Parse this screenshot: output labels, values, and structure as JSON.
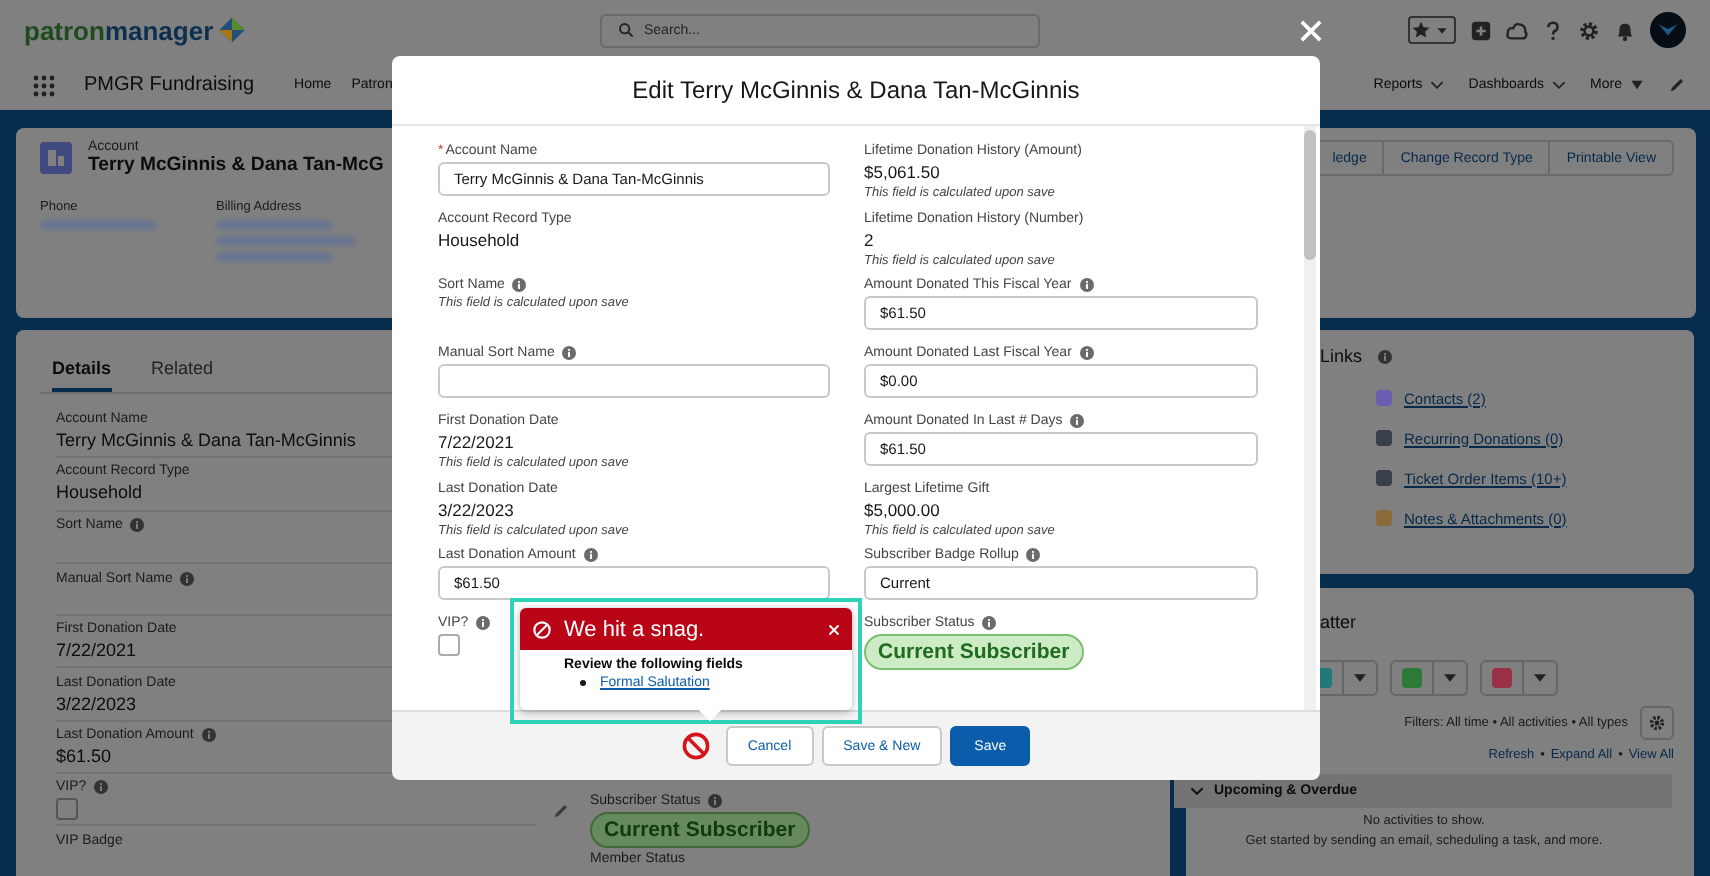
{
  "header": {
    "logo_lead": "patron",
    "logo_rest": "manager",
    "search": {
      "placeholder": "Search..."
    }
  },
  "nav": {
    "app_name": "PMGR Fundraising",
    "items": [
      {
        "label": "Home",
        "selected": false
      },
      {
        "label": "Patron",
        "selected": false
      }
    ],
    "right_items": [
      {
        "label": "Reports",
        "kind": "menu"
      },
      {
        "label": "Dashboards",
        "kind": "menu"
      },
      {
        "label": "More",
        "kind": "overflow"
      }
    ]
  },
  "record": {
    "object": "Account",
    "title": "Terry McGinnis & Dana Tan-McG",
    "fields": [
      {
        "label": "Phone"
      },
      {
        "label": "Billing Address"
      }
    ],
    "actions": [
      "ledge",
      "Change Record Type",
      "Printable View"
    ]
  },
  "detail_tabs": [
    {
      "label": "Details",
      "selected": true
    },
    {
      "label": "Related",
      "selected": false
    }
  ],
  "details": [
    {
      "label": "Account Name",
      "value": "Terry McGinnis & Dana Tan-McGinnis",
      "info": false,
      "kind": "text"
    },
    {
      "label": "Account Record Type",
      "value": "Household",
      "info": false,
      "kind": "text"
    },
    {
      "label": "Sort Name",
      "info": true,
      "kind": "text"
    },
    {
      "label": "Manual Sort Name",
      "info": true,
      "kind": "text"
    },
    {
      "label": "First Donation Date",
      "value": "7/22/2021",
      "info": false,
      "kind": "text"
    },
    {
      "label": "Last Donation Date",
      "value": "3/22/2023",
      "info": false,
      "kind": "text"
    },
    {
      "label": "Last Donation Amount",
      "value": "$61.50",
      "info": true,
      "kind": "text"
    },
    {
      "label": "VIP?",
      "info": true,
      "kind": "checkbox",
      "checked": false
    },
    {
      "label": "VIP Badge",
      "info": false,
      "kind": "text"
    }
  ],
  "details_right": [
    {
      "label": "Subscriber Status",
      "value": "Current Subscriber",
      "info": true,
      "kind": "badge"
    },
    {
      "label": "Member Status",
      "info": false,
      "kind": "text"
    }
  ],
  "related_links": {
    "title": "Links",
    "items": [
      {
        "label": "Contacts (2)",
        "color": "#6a5cae"
      },
      {
        "label": "Recurring Donations (0)",
        "color": "#3a3f4c"
      },
      {
        "label": "Ticket Order Items (10+)",
        "color": "#3a3f4c"
      },
      {
        "label": "Notes & Attachments (0)",
        "color": "#8a6a3a"
      }
    ]
  },
  "activity": {
    "title": "atter",
    "buttons": [
      {
        "color": "#1f7a78"
      },
      {
        "color": "#2d7a38"
      },
      {
        "color": "#9a3146"
      }
    ],
    "filters": "Filters: All time • All activities • All types",
    "links": [
      "Refresh",
      "Expand All",
      "View All"
    ],
    "separator": "•",
    "section": {
      "title": "Upcoming & Overdue",
      "expanded": true
    },
    "empty": "No activities to show.",
    "hint": "Get started by sending an email, scheduling a task, and more."
  },
  "modal": {
    "title": "Edit Terry McGinnis & Dana Tan-McGinnis",
    "fields": [
      {
        "label": "Account Name",
        "marker": "*",
        "kind": "input",
        "value": "Terry McGinnis & Dana Tan-McGinnis",
        "info": false
      },
      {
        "label": "Lifetime Donation History (Amount)",
        "kind": "output",
        "value": "$5,061.50",
        "note": "This field is calculated upon save",
        "info": false
      },
      {
        "label": "Account Record Type",
        "kind": "output",
        "value": "Household",
        "info": false
      },
      {
        "label": "Lifetime Donation History (Number)",
        "kind": "output",
        "value": "2",
        "note": "This field is calculated upon save",
        "info": false
      },
      {
        "label": "Sort Name",
        "kind": "output",
        "note": "This field is calculated upon save",
        "info": true
      },
      {
        "label": "Amount Donated This Fiscal Year",
        "kind": "input",
        "value": "$61.50",
        "info": true
      },
      {
        "label": "Manual Sort Name",
        "kind": "input",
        "info": true
      },
      {
        "label": "Amount Donated Last Fiscal Year",
        "kind": "input",
        "value": "$0.00",
        "info": true
      },
      {
        "label": "First Donation Date",
        "kind": "output",
        "value": "7/22/2021",
        "note": "This field is calculated upon save",
        "info": false
      },
      {
        "label": "Amount Donated In Last # Days",
        "kind": "input",
        "value": "$61.50",
        "info": true
      },
      {
        "label": "Last Donation Date",
        "kind": "output",
        "value": "3/22/2023",
        "note": "This field is calculated upon save",
        "info": false
      },
      {
        "label": "Largest Lifetime Gift",
        "kind": "output",
        "value": "$5,000.00",
        "note": "This field is calculated upon save",
        "info": false
      },
      {
        "label": "Last Donation Amount",
        "kind": "input",
        "value": "$61.50",
        "info": true
      },
      {
        "label": "Subscriber Badge Rollup",
        "kind": "input",
        "value": "Current",
        "info": true
      },
      {
        "label": "VIP?",
        "kind": "checkbox",
        "checked": false,
        "info": true
      },
      {
        "label": "Subscriber Status",
        "kind": "badge",
        "value": "Current Subscriber",
        "info": true
      }
    ],
    "buttons": [
      {
        "label": "Cancel",
        "kind": "neutral"
      },
      {
        "label": "Save & New",
        "kind": "neutral"
      },
      {
        "label": "Save",
        "kind": "brand"
      }
    ]
  },
  "error": {
    "title": "We hit a snag.",
    "heading": "Review the following fields",
    "fields": [
      "Formal Salutation"
    ]
  }
}
